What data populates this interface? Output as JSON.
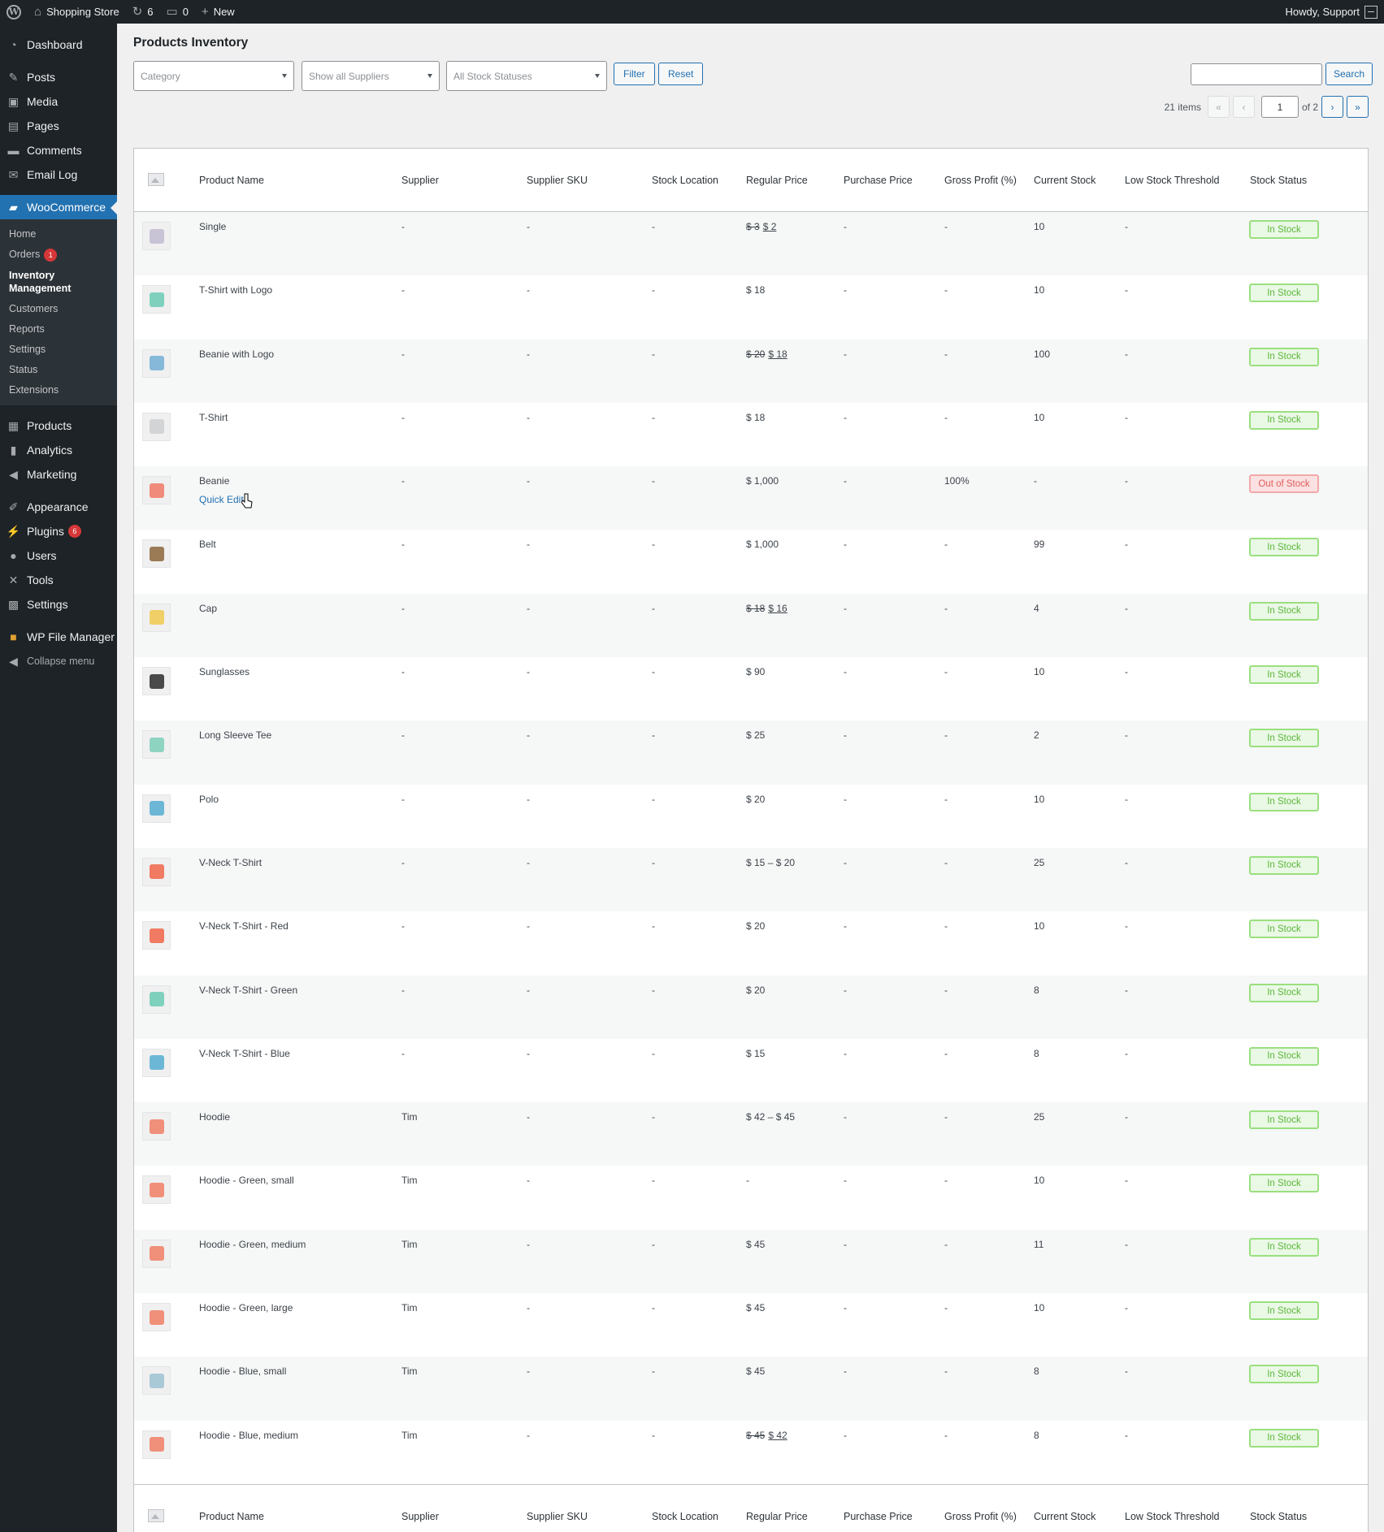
{
  "adminbar": {
    "site_name": "Shopping Store",
    "updates_count": "6",
    "comments_count": "0",
    "new_label": "New",
    "howdy": "Howdy, Support"
  },
  "sidebar": {
    "items": [
      {
        "label": "Dashboard",
        "icon": "dashboard-icon"
      },
      {
        "label": "Posts",
        "icon": "pin-icon"
      },
      {
        "label": "Media",
        "icon": "media-icon"
      },
      {
        "label": "Pages",
        "icon": "pages-icon"
      },
      {
        "label": "Comments",
        "icon": "comment-icon"
      },
      {
        "label": "Email Log",
        "icon": "email-icon"
      },
      {
        "label": "WooCommerce",
        "icon": "woo-icon"
      },
      {
        "label": "Products",
        "icon": "archive-icon"
      },
      {
        "label": "Analytics",
        "icon": "bar-chart-icon"
      },
      {
        "label": "Marketing",
        "icon": "megaphone-icon"
      },
      {
        "label": "Appearance",
        "icon": "brush-icon"
      },
      {
        "label": "Plugins",
        "icon": "plug-icon",
        "badge": "6"
      },
      {
        "label": "Users",
        "icon": "user-icon"
      },
      {
        "label": "Tools",
        "icon": "wrench-icon"
      },
      {
        "label": "Settings",
        "icon": "settings-icon"
      },
      {
        "label": "WP File Manager",
        "icon": "folder-icon"
      },
      {
        "label": "Collapse menu",
        "icon": "collapse-icon"
      }
    ],
    "submenu": [
      {
        "label": "Home"
      },
      {
        "label": "Orders",
        "badge": "1"
      },
      {
        "label": "Inventory Management"
      },
      {
        "label": "Customers"
      },
      {
        "label": "Reports"
      },
      {
        "label": "Settings"
      },
      {
        "label": "Status"
      },
      {
        "label": "Extensions"
      }
    ]
  },
  "page": {
    "title": "Products Inventory",
    "filters": {
      "category_placeholder": "Category",
      "suppliers_placeholder": "Show all Suppliers",
      "stock_status_placeholder": "All Stock Statuses",
      "filter_label": "Filter",
      "reset_label": "Reset",
      "search_label": "Search"
    },
    "pagination": {
      "items": "21 items",
      "first": "«",
      "prev": "‹",
      "current_page": "1",
      "of": "of 2",
      "next": "›",
      "last": "»"
    }
  },
  "table": {
    "columns": [
      "Product Name",
      "Supplier",
      "Supplier SKU",
      "Stock Location",
      "Regular Price",
      "Purchase Price",
      "Gross Profit (%)",
      "Current Stock",
      "Low Stock Threshold",
      "Stock Status"
    ],
    "rows": [
      {
        "name": "Single",
        "supplier": "-",
        "sku": "-",
        "location": "-",
        "price_old": "$ 3",
        "price_new": "$ 2",
        "purchase": "-",
        "profit": "-",
        "stock": "10",
        "low": "-",
        "status": "In Stock",
        "thumb_color": "#c9c3d6"
      },
      {
        "name": "T-Shirt with Logo",
        "supplier": "-",
        "sku": "-",
        "location": "-",
        "price": "$ 18",
        "purchase": "-",
        "profit": "-",
        "stock": "10",
        "low": "-",
        "status": "In Stock",
        "thumb_color": "#7fd1bd"
      },
      {
        "name": "Beanie with Logo",
        "supplier": "-",
        "sku": "-",
        "location": "-",
        "price_old": "$ 20",
        "price_new": "$ 18",
        "purchase": "-",
        "profit": "-",
        "stock": "100",
        "low": "-",
        "status": "In Stock",
        "thumb_color": "#86b8d9"
      },
      {
        "name": "T-Shirt",
        "supplier": "-",
        "sku": "-",
        "location": "-",
        "price": "$ 18",
        "purchase": "-",
        "profit": "-",
        "stock": "10",
        "low": "-",
        "status": "In Stock",
        "thumb_color": "#d2d4d6"
      },
      {
        "name": "Beanie",
        "supplier": "-",
        "sku": "-",
        "location": "-",
        "price": "$ 1,000",
        "purchase": "-",
        "profit": "100%",
        "stock": "-",
        "low": "-",
        "status": "Out of Stock",
        "thumb_color": "#f08a7a",
        "quick_edit": "Quick Edit"
      },
      {
        "name": "Belt",
        "supplier": "-",
        "sku": "-",
        "location": "-",
        "price": "$ 1,000",
        "purchase": "-",
        "profit": "-",
        "stock": "99",
        "low": "-",
        "status": "In Stock",
        "thumb_color": "#9a7b55"
      },
      {
        "name": "Cap",
        "supplier": "-",
        "sku": "-",
        "location": "-",
        "price_old": "$ 18",
        "price_new": "$ 16",
        "purchase": "-",
        "profit": "-",
        "stock": "4",
        "low": "-",
        "status": "In Stock",
        "thumb_color": "#f0cf66"
      },
      {
        "name": "Sunglasses",
        "supplier": "-",
        "sku": "-",
        "location": "-",
        "price": "$ 90",
        "purchase": "-",
        "profit": "-",
        "stock": "10",
        "low": "-",
        "status": "In Stock",
        "thumb_color": "#4a4a4a"
      },
      {
        "name": "Long Sleeve Tee",
        "supplier": "-",
        "sku": "-",
        "location": "-",
        "price": "$ 25",
        "purchase": "-",
        "profit": "-",
        "stock": "2",
        "low": "-",
        "status": "In Stock",
        "thumb_color": "#8fd3c1"
      },
      {
        "name": "Polo",
        "supplier": "-",
        "sku": "-",
        "location": "-",
        "price": "$ 20",
        "purchase": "-",
        "profit": "-",
        "stock": "10",
        "low": "-",
        "status": "In Stock",
        "thumb_color": "#6db7d6"
      },
      {
        "name": "V-Neck T-Shirt",
        "supplier": "-",
        "sku": "-",
        "location": "-",
        "price": "$ 15 – $ 20",
        "purchase": "-",
        "profit": "-",
        "stock": "25",
        "low": "-",
        "status": "In Stock",
        "thumb_color": "#f07a62"
      },
      {
        "name": "V-Neck T-Shirt - Red",
        "supplier": "-",
        "sku": "-",
        "location": "-",
        "price": "$ 20",
        "purchase": "-",
        "profit": "-",
        "stock": "10",
        "low": "-",
        "status": "In Stock",
        "thumb_color": "#f07a62"
      },
      {
        "name": "V-Neck T-Shirt - Green",
        "supplier": "-",
        "sku": "-",
        "location": "-",
        "price": "$ 20",
        "purchase": "-",
        "profit": "-",
        "stock": "8",
        "low": "-",
        "status": "In Stock",
        "thumb_color": "#7fd1bd"
      },
      {
        "name": "V-Neck T-Shirt - Blue",
        "supplier": "-",
        "sku": "-",
        "location": "-",
        "price": "$ 15",
        "purchase": "-",
        "profit": "-",
        "stock": "8",
        "low": "-",
        "status": "In Stock",
        "thumb_color": "#6db7d6"
      },
      {
        "name": "Hoodie",
        "supplier": "Tim",
        "sku": "-",
        "location": "-",
        "price": "$ 42 – $ 45",
        "purchase": "-",
        "profit": "-",
        "stock": "25",
        "low": "-",
        "status": "In Stock",
        "thumb_color": "#f0907a"
      },
      {
        "name": "Hoodie - Green, small",
        "supplier": "Tim",
        "sku": "-",
        "location": "-",
        "price": "-",
        "purchase": "-",
        "profit": "-",
        "stock": "10",
        "low": "-",
        "status": "In Stock",
        "thumb_color": "#f0907a"
      },
      {
        "name": "Hoodie - Green, medium",
        "supplier": "Tim",
        "sku": "-",
        "location": "-",
        "price": "$ 45",
        "purchase": "-",
        "profit": "-",
        "stock": "11",
        "low": "-",
        "status": "In Stock",
        "thumb_color": "#f0907a"
      },
      {
        "name": "Hoodie - Green, large",
        "supplier": "Tim",
        "sku": "-",
        "location": "-",
        "price": "$ 45",
        "purchase": "-",
        "profit": "-",
        "stock": "10",
        "low": "-",
        "status": "In Stock",
        "thumb_color": "#f0907a"
      },
      {
        "name": "Hoodie - Blue, small",
        "supplier": "Tim",
        "sku": "-",
        "location": "-",
        "price": "$ 45",
        "purchase": "-",
        "profit": "-",
        "stock": "8",
        "low": "-",
        "status": "In Stock",
        "thumb_color": "#a9c9d6"
      },
      {
        "name": "Hoodie - Blue, medium",
        "supplier": "Tim",
        "sku": "-",
        "location": "-",
        "price_old": "$ 45",
        "price_new": "$ 42",
        "purchase": "-",
        "profit": "-",
        "stock": "8",
        "low": "-",
        "status": "In Stock",
        "thumb_color": "#f0907a"
      }
    ]
  },
  "colors": {
    "accent": "#2271b1",
    "admin_dark": "#1d2327",
    "in_stock": "#5cb83a",
    "out_of_stock": "#e05b5b"
  }
}
